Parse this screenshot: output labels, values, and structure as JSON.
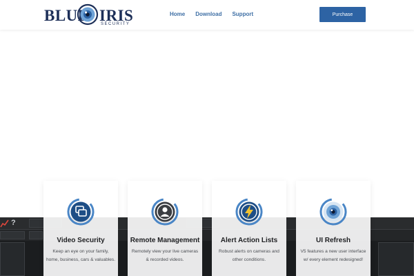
{
  "brand": {
    "logo_blue": "BLUE",
    "logo_iris": "IRIS",
    "logo_security": "SECURITY"
  },
  "nav": [
    {
      "label": "Home"
    },
    {
      "label": "Download"
    },
    {
      "label": "Support"
    }
  ],
  "purchase_label": "Purchase",
  "features": [
    {
      "title": "Video Security",
      "desc_line1": "Keep an eye on your family,",
      "desc_line2": "home, business, cars & valuables.",
      "icon": "camera-screens-icon"
    },
    {
      "title": "Remote Management",
      "desc_line1": "Remotely view your live cameras",
      "desc_line2": "& recorded videos.",
      "icon": "user-icon"
    },
    {
      "title": "Alert Action Lists",
      "desc_line1": "Robust alerts on cameras and",
      "desc_line2": "other conditions.",
      "icon": "lightning-icon"
    },
    {
      "title": "UI Refresh",
      "desc_line1": "V5 features a new user interface",
      "desc_line2": "w/ every element redesigned!",
      "icon": "eye-icon"
    }
  ],
  "colors": {
    "brand_navy": "#1d2f58",
    "nav_blue": "#3e6fa5",
    "button_blue": "#2d63a4",
    "icon_blue": "#4a86c6",
    "bolt_yellow": "#f2c230"
  }
}
